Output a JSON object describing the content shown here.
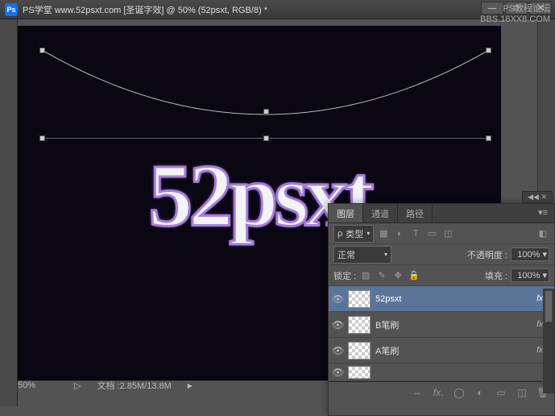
{
  "titlebar": {
    "app_icon": "Ps",
    "title": "PS学堂  www.52psxt.com [圣诞字效] @ 50% (52psxt, RGB/8) *"
  },
  "watermark": {
    "line1": "PS教程论坛",
    "line2": "BBS.16XX8.COM"
  },
  "canvas": {
    "text": "52psxt"
  },
  "statusbar": {
    "zoom": "50%",
    "docinfo": "文档 :2.85M/13.8M"
  },
  "panel": {
    "tabs": {
      "layers": "图层",
      "channels": "通道",
      "paths": "路径"
    },
    "kind_label": "类型",
    "blend_mode": "正常",
    "opacity_label": "不透明度 :",
    "opacity_value": "100%",
    "lock_label": "锁定 :",
    "fill_label": "填充 :",
    "fill_value": "100%",
    "layers": [
      {
        "name": "52psxt",
        "fx": "fx"
      },
      {
        "name": "B笔刷",
        "fx": "fx"
      },
      {
        "name": "A笔刷",
        "fx": "fx"
      }
    ]
  }
}
